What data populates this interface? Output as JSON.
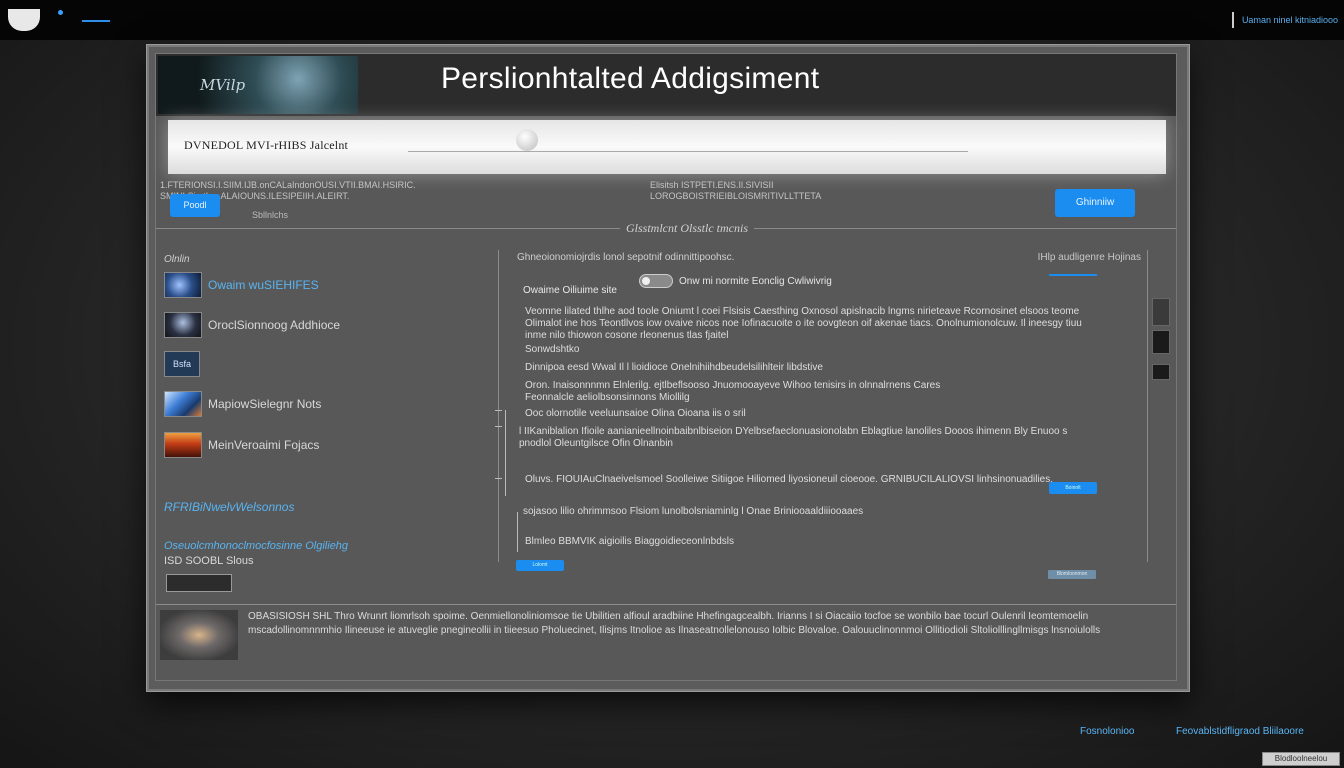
{
  "os": {
    "right_label": "Uaman ninel kitniadiooo"
  },
  "app": {
    "thumb_text": "MVilp",
    "title": "Perslionhtalted Addigsiment"
  },
  "search": {
    "label": "DVNEDOL MVI-rHIBS Jalcelnt"
  },
  "info": {
    "left_line1": "1.FTERIONSI.I.SIIM.IJB.onCALaIndonOUSI.VTII.BMAI.HSIRIC.",
    "left_line2": "SMINI.Siprtlon.ALAIOUNS.ILESIPEIIH.ALEIRT.",
    "mid_line1": "Elisitsh      ISTPETI.ENS.Il.SIVISII",
    "mid_line2": "LOROGBOISTRIEIBLOISMRITIVLLTTETA"
  },
  "buttons": {
    "left": "Poodl",
    "right": "Ghinniiw",
    "sub_note": "Sbllnlchs"
  },
  "section_title": "Glsstmlcnt  Olsstlc tmcnis",
  "sidebar": {
    "head": "Olnlin",
    "items": [
      {
        "label": "Owaim wuSIEHIFES",
        "style": "link"
      },
      {
        "label": "OroclSionnoog Addhioce",
        "style": "text"
      },
      {
        "label": "Bsfa",
        "style": "badge"
      },
      {
        "label": "MapiowSielegnr Nots",
        "style": "text"
      },
      {
        "label": "MeinVeroaimi Fojacs",
        "style": "text"
      }
    ],
    "link1": "RFRIBiNwelvWelsonnos",
    "link2": "Oseuolcmhonoclmocfosinne Olgiliehg",
    "text3": "ISD SOOBL Slous"
  },
  "content": {
    "head": "Ghneoionomiojrdis lonol sepotnif odinnittipoohsc.",
    "head_right": "IHlp audligenre Hojinas",
    "toggle_label": "Onw mi normite Eonclig Cwliwivrig",
    "label": "Owaime Oiliuime site",
    "para1": "Veomne lilated thlhe aod toole Oniumt l coei Flsisis Caesthing Oxnosol apislnacib lngms nirieteave Rcornosinet elsoos teome Olimalot ine hos Teontllvos iow ovaive nicos noe Iofinacuoite o ite oovgteon oif akenae tiacs. Onolnumionolcuw. Il ineesgy tiuu inme nilo thiowon cosone rleonenus tlas fjaitel",
    "para1_tail": "Sonwdshtko",
    "para2": "Dinnipoa eesd Wwal Il l lioidioce Onelnihiihdbeudelsilihlteir libdstive",
    "para3": "Oron. Inaisonnnmn Elnlerilg. ejtlbeflsooso Jnuomooayeve Wihoo tenisirs in olnnalrnens Cares Feonnalcle    aeliolbsonsinnons Miollilg",
    "para4": "Ooc olornotile veeluunsaioe Olina Oioana iis o sril",
    "para5": "l IIKaniblalion Ifioile aanianieellnoinbaibnlbiseion DYelbsefaeclonuasionolabn Eblagtiue lanoliles Dooos ihimenn Bly Enuoo s pnodlol Oleuntgilsce Ofin Olnanbin",
    "para6": "Oluvs. FIOUIAuClnaeivelsmoel Soolleiwe Sitiigoe Hiliomed liyosioneuil cioeooe. GRNIBUCILALIOVSI linhsinonuadilies.",
    "para7": "sojasoo lilio ohrimmsoo Flsiom lunolbolsniaminlg l Onae Briniooaaldiiiooaaes",
    "para8": "Blmleo BBMVIK aigioilis Biaggoidieceonlnbdsls",
    "btn_small": "Boinnlt",
    "btn_bottom": "Lolomt",
    "btn_ghost": "Blomloonmon"
  },
  "footer": {
    "text": "OBASISIOSH SHL Thro Wrunrt liomrlsoh spoime. Oenmiellonoliniomsoe tie Ubilitien alfioul aradbiine Hhefingagcealbh. Irianns I si Oiacaiio tocfoe se wonbilo bae tocurl Oulenril Ieomtemoelin mscadollinomnnmhio Ilineeuse ie atuveglie pnegineollii in tiieesuo Pholuecinet, Ilisjms Itnolioe as Ilnaseatnollelonouso Iolbic Blovaloe. Oalouuclinonnmoi Ollitiodioli Sltoliolllingllmisgs lnsnoiulolls"
  },
  "corner": {
    "link1": "Fosnolonioo",
    "link2": "Feovablstidfligraod Bliilaoore",
    "badge": "Blodloolneelou"
  },
  "colors": {
    "accent": "#1b8cf0",
    "link": "#58b4f2",
    "window_bg": "#585858",
    "header_bg": "#2c2c2c"
  }
}
